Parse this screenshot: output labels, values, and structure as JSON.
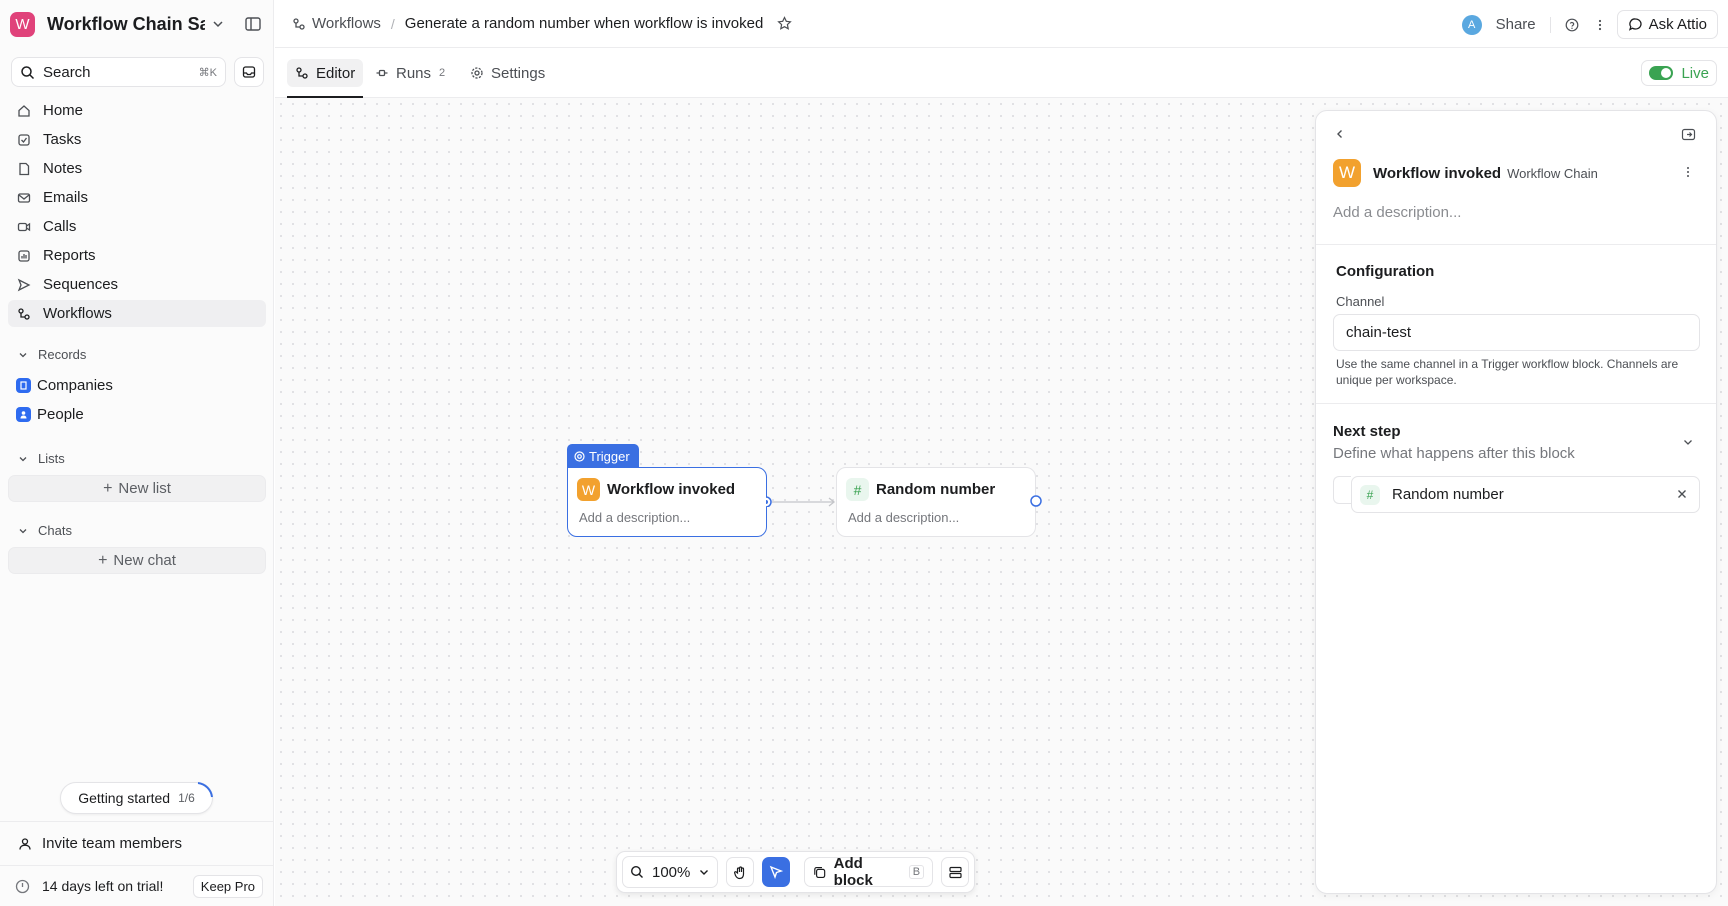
{
  "workspace": {
    "initial": "W",
    "name": "Workflow Chain Sa...",
    "color": "#e0427a"
  },
  "search": {
    "label": "Search",
    "shortcut": "⌘K"
  },
  "nav": [
    {
      "label": "Home",
      "icon": "home-icon"
    },
    {
      "label": "Tasks",
      "icon": "task-check-icon"
    },
    {
      "label": "Notes",
      "icon": "note-icon"
    },
    {
      "label": "Emails",
      "icon": "mail-icon"
    },
    {
      "label": "Calls",
      "icon": "video-icon"
    },
    {
      "label": "Reports",
      "icon": "report-icon"
    },
    {
      "label": "Sequences",
      "icon": "send-icon"
    },
    {
      "label": "Workflows",
      "icon": "workflow-icon",
      "active": true
    }
  ],
  "records": {
    "heading": "Records",
    "items": [
      "Companies",
      "People"
    ]
  },
  "lists": {
    "heading": "Lists",
    "new_label": "New list"
  },
  "chats": {
    "heading": "Chats",
    "new_label": "New chat"
  },
  "getting_started": {
    "label": "Getting started",
    "progress": "1/6"
  },
  "invite": {
    "label": "Invite team members"
  },
  "trial": {
    "label": "14 days left on trial!",
    "button": "Keep Pro"
  },
  "header": {
    "breadcrumb_root": "Workflows",
    "separator": "/",
    "title": "Generate a random number when workflow is invoked",
    "avatar_initial": "A",
    "share": "Share",
    "ask": "Ask Attio"
  },
  "tabs": [
    {
      "label": "Editor",
      "active": true
    },
    {
      "label": "Runs",
      "count": "2"
    },
    {
      "label": "Settings"
    }
  ],
  "live": {
    "label": "Live",
    "on": true
  },
  "canvas": {
    "trigger_tag": "Trigger",
    "nodes": [
      {
        "badge": "W",
        "title": "Workflow invoked",
        "desc": "Add a description..."
      },
      {
        "badge": "#",
        "title": "Random number",
        "desc": "Add a description..."
      }
    ]
  },
  "toolbar": {
    "zoom": "100%",
    "add_block": "Add block",
    "add_block_key": "B"
  },
  "panel": {
    "badge": "W",
    "title": "Workflow invoked",
    "subtitle": "Workflow Chain",
    "desc_placeholder": "Add a description...",
    "config_heading": "Configuration",
    "channel_label": "Channel",
    "channel_value": "chain-test",
    "channel_help": "Use the same channel in a Trigger workflow block. Channels are unique per workspace.",
    "next_heading": "Next step",
    "next_sub": "Define what happens after this block",
    "next_step": {
      "badge": "#",
      "label": "Random number"
    }
  },
  "colors": {
    "accent": "#3a6fe2",
    "live_green": "#3aa352",
    "workflow_orange": "#f2a12e"
  }
}
